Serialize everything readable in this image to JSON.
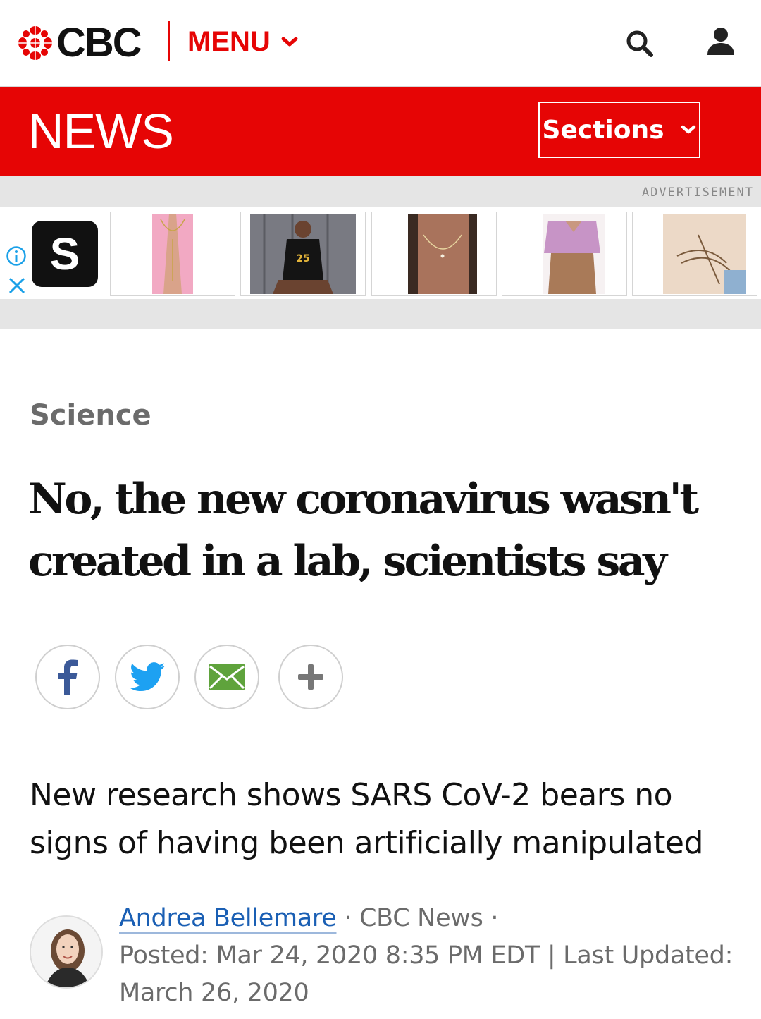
{
  "header": {
    "brand": "CBC",
    "menu_label": "MENU",
    "icons": {
      "gem": "cbc-gem-logo",
      "search": "search-icon",
      "account": "account-icon",
      "menu_chevron": "chevron-down-icon"
    },
    "brand_color": "#e60505"
  },
  "news_bar": {
    "title": "NEWS",
    "sections_label": "Sections"
  },
  "ad": {
    "label": "ADVERTISEMENT",
    "logo_letter": "S",
    "icons": {
      "info": "info-icon",
      "close": "close-icon"
    },
    "products": [
      "product-necklace-pink",
      "product-jersey",
      "product-necklace",
      "product-blouse",
      "product-sandals"
    ]
  },
  "article": {
    "category": "Science",
    "headline": "No, the new coronavirus wasn't created in a lab, scientists say",
    "deck": "New research shows SARS CoV-2 bears no signs of having been artificially manipulated",
    "author": "Andrea Bellemare",
    "separator1": " · ",
    "source": "CBC News",
    "separator2": " · ",
    "posted": "Posted: Mar 24, 2020 8:35 PM EDT | Last Updated: March 26, 2020"
  },
  "share": {
    "buttons": [
      {
        "name": "facebook",
        "icon": "facebook-icon"
      },
      {
        "name": "twitter",
        "icon": "twitter-icon"
      },
      {
        "name": "email",
        "icon": "email-icon"
      },
      {
        "name": "more",
        "icon": "plus-icon"
      }
    ]
  }
}
